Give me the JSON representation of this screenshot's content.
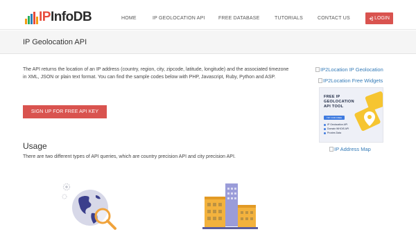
{
  "header": {
    "logo_prefix": "IP",
    "logo_suffix": "InfoDB",
    "logo_bar_colors": [
      "#f39c12",
      "#27ae60",
      "#2980b9",
      "#e74c3c",
      "#f39c12"
    ],
    "nav": [
      {
        "label": "HOME"
      },
      {
        "label": "IP GEOLOCATION API"
      },
      {
        "label": "FREE DATABASE"
      },
      {
        "label": "TUTORIALS"
      },
      {
        "label": "CONTACT US"
      }
    ],
    "login_label": "LOGIN",
    "login_icon": "sign-in-icon"
  },
  "page": {
    "title": "IP Geolocation API",
    "intro": "The API returns the location of an IP address (country, region, city, zipcode, latitude, longitude) and the associated timezone in XML, JSON or plain text format. You can find the sample codes below with PHP, Javascript, Ruby, Python and ASP.",
    "signup_label": "SIGN UP FOR FREE API KEY",
    "usage_heading": "Usage",
    "usage_text": "There are two different types of API queries, which are country precision API and city precision API."
  },
  "sidebar": {
    "link1": "IP2Location IP Geolocation",
    "link2": "IP2Location Free Widgets",
    "ad": {
      "title": "FREE IP\nGEOLOCATION\nAPI TOOL",
      "button": "TRY FOR FREE",
      "items": [
        "IP Geolocation API",
        "Domain WHOIS API",
        "Proxies Data"
      ]
    },
    "link3": "IP Address Map"
  },
  "colors": {
    "accent_red": "#d9534f",
    "link_blue": "#337ab7"
  }
}
